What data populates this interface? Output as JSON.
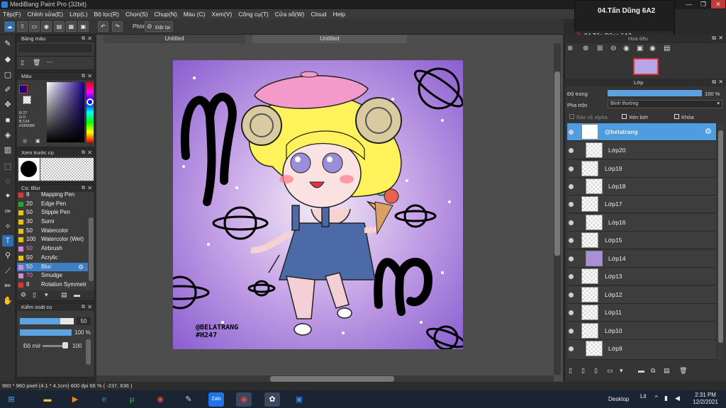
{
  "window": {
    "title": "MediBang Paint Pro (32bit)"
  },
  "menu": [
    "Tệp(F)",
    "Chỉnh sửa(E)",
    "Lớp(L)",
    "Bộ lọc(R)",
    "Chọn(S)",
    "Chụp(N)",
    "Màu (C)",
    "Xem(V)",
    "Công cụ(T)",
    "Cửa sổ(W)",
    "Cloud",
    "Help"
  ],
  "toolbar": {
    "key_label": "Phím",
    "reset_label": "Đặt lại"
  },
  "notification": {
    "title": "04.Tấn Dũng 6A2",
    "item": "04.Tấn Dũng 6A2"
  },
  "doc_tabs": [
    "Untitled",
    "Untitled"
  ],
  "panels": {
    "palette_title": "Bảng màu",
    "palette_hint": "---",
    "color_title": "Màu",
    "color_values": [
      "R:27",
      "G:0",
      "B:134",
      "#1B0086"
    ],
    "brush_preview_title": "Xem trước cọ",
    "brush_title": "Cọ: Blur",
    "brush_control_title": "Kiểm soát cọ",
    "brush_size_value": "50",
    "brush_opacity_value": "100 %",
    "density_label": "Độ mờ",
    "density_value": "100"
  },
  "brushes": [
    {
      "num": "8",
      "name": "Mapping Pen",
      "color": "#d23a3a"
    },
    {
      "num": "20",
      "name": "Edge Pen",
      "color": "#2aa52a"
    },
    {
      "num": "50",
      "name": "Stipple Pen",
      "color": "#e8c21a"
    },
    {
      "num": "30",
      "name": "Sumi",
      "color": "#e8c21a"
    },
    {
      "num": "50",
      "name": "Watercolor",
      "color": "#e8c21a"
    },
    {
      "num": "100",
      "name": "Watercolor (Wet)",
      "color": "#e8c21a"
    },
    {
      "num": "50",
      "name": "Airbrush",
      "color": "#d28ad2"
    },
    {
      "num": "50",
      "name": "Acrylic",
      "color": "#e8c21a"
    },
    {
      "num": "50",
      "name": "Blur",
      "color": "#d28ad2"
    },
    {
      "num": "70",
      "name": "Smudge",
      "color": "#d28ad2"
    },
    {
      "num": "8",
      "name": "Rotation Symmetr",
      "color": "#d23a3a"
    }
  ],
  "right": {
    "nav_title": "Hoa tiêu",
    "layer_title": "Lớp",
    "opacity_label": "Độ trong",
    "opacity_value": "100 %",
    "blend_label": "Pha trộn",
    "blend_value": "Bình thường",
    "protect_alpha": "Bảo vệ alpha",
    "clipping": "Xén bớt",
    "lock": "Khóa"
  },
  "layers": [
    "@belatrang",
    "Lớp20",
    "Lớp19",
    "Lớp18",
    "Lớp17",
    "Lớp16",
    "Lớp15",
    "Lớp14",
    "Lớp13",
    "Lớp12",
    "Lớp11",
    "Lớp10",
    "Lớp9"
  ],
  "artwork": {
    "signature_line1": "@BELATRANG",
    "signature_line2": "#H247"
  },
  "status": {
    "text": "960 * 960 pixel   (4.1 * 4.1cm)   600 dpi   66 %   ( -237, 636 )"
  },
  "taskbar": {
    "desktop_label": "Desktop",
    "lang": "Lit",
    "time": "2:31 PM",
    "date": "12/2/2021"
  },
  "colors": {
    "accent": "#3d7fc4",
    "fg_color": "#1B0086",
    "canvas_bg": "#a57bd6"
  }
}
